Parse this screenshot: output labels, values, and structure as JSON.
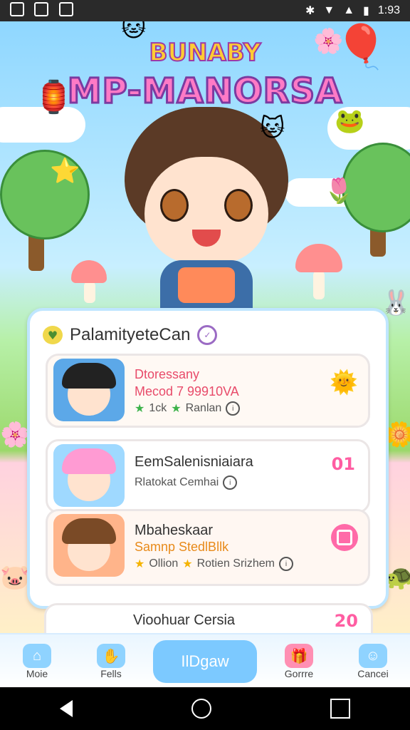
{
  "status_bar": {
    "time": "1:93"
  },
  "header": {
    "line1": "BUNABY",
    "line2": "MP-MANORSA"
  },
  "panel": {
    "title": "PalamityeteCan",
    "items": [
      {
        "line1": "Dtoressany",
        "line2": "Mecod 7 99910VA",
        "line3a": "1ck",
        "line3b": "Ranlan"
      },
      {
        "line1": "EemSalenisniaiara",
        "line2": "",
        "line3a": "Rlatokat Cemhai",
        "line3b": "",
        "badge": "01"
      },
      {
        "line1": "Mbaheskaar",
        "line2": "Samnp StedlBllk",
        "line3a": "Ollion",
        "line3b": "Rotien Srizhem"
      }
    ]
  },
  "next_item": {
    "title": "Vioohuar Cersia",
    "badge": "20"
  },
  "nav": {
    "items": [
      {
        "label": "Moie",
        "icon": "home-icon"
      },
      {
        "label": "Fells",
        "icon": "hand-icon"
      },
      {
        "label": "IlDgaw",
        "icon": ""
      },
      {
        "label": "Gorrre",
        "icon": "gift-icon"
      },
      {
        "label": "Cancei",
        "icon": "cloud-face-icon"
      }
    ]
  },
  "colors": {
    "accent": "#ff5da2",
    "nav_blue": "#7cc9ff",
    "panel_border": "#bfe6ff"
  }
}
